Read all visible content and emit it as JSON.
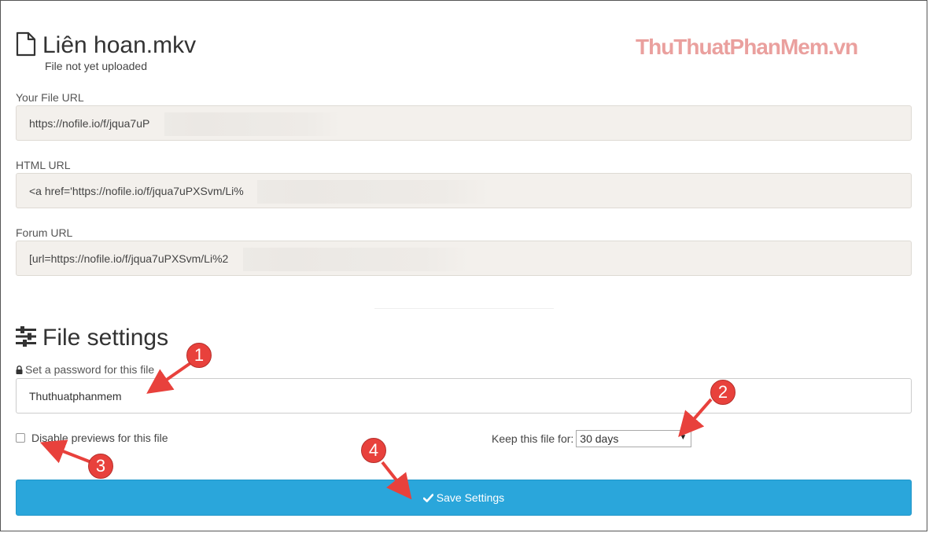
{
  "watermark": "ThuThuatPhanMem.vn",
  "file": {
    "name": "Liên hoan.mkv",
    "status": "File not yet uploaded"
  },
  "urls": {
    "file_url_label": "Your File URL",
    "file_url_value": "https://nofile.io/f/jqua7uP",
    "html_url_label": "HTML URL",
    "html_url_value": "<a href='https://nofile.io/f/jqua7uPXSvm/Li%",
    "forum_url_label": "Forum URL",
    "forum_url_value": "[url=https://nofile.io/f/jqua7uPXSvm/Li%2"
  },
  "settings": {
    "title": "File settings",
    "password_label": "Set a password for this file",
    "password_value": "Thuthuatphanmem",
    "disable_previews_label": "Disable previews for this file",
    "disable_previews_checked": false,
    "keep_label": "Keep this file for:",
    "keep_value": "30 days",
    "save_label": "Save Settings"
  },
  "annotations": {
    "badge_1": "1",
    "badge_2": "2",
    "badge_3": "3",
    "badge_4": "4",
    "color": "#e8413c"
  },
  "colors": {
    "accent": "#2aa6db",
    "url_box_bg": "#f3f0ec"
  }
}
